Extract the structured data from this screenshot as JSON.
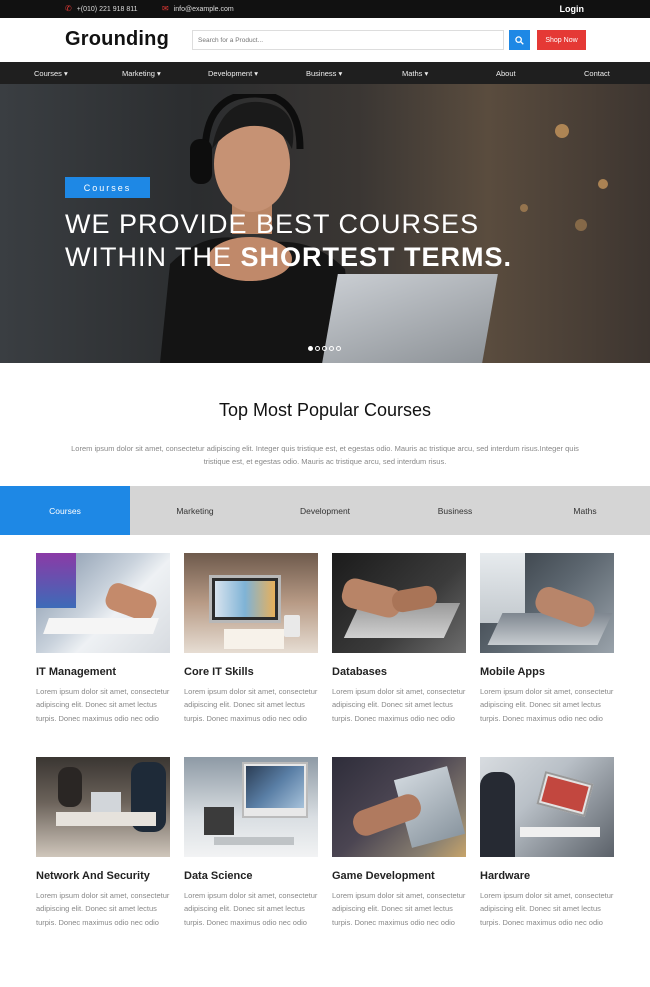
{
  "topbar": {
    "phone": "+(010) 221 918 811",
    "email": "info@example.com",
    "login": "Login"
  },
  "header": {
    "logo": "Grounding",
    "search_placeholder": "Search for a Product...",
    "shop_button": "Shop Now"
  },
  "nav": {
    "items": [
      {
        "label": "Courses ▾"
      },
      {
        "label": "Marketing ▾"
      },
      {
        "label": "Development ▾"
      },
      {
        "label": "Business ▾"
      },
      {
        "label": "Maths ▾"
      },
      {
        "label": "About"
      },
      {
        "label": "Contact"
      }
    ]
  },
  "hero": {
    "badge": "Courses",
    "line1": "WE PROVIDE BEST COURSES",
    "line2_light": "WITHIN THE ",
    "line2_bold": "SHORTEST TERMS.",
    "slides": 5,
    "active_slide": 1
  },
  "section": {
    "title": "Top Most Popular Courses",
    "description": "Lorem ipsum dolor sit amet, consectetur adipiscing elit. Integer quis tristique est, et egestas odio. Mauris ac tristique arcu, sed interdum risus.Integer quis tristique est, et egestas odio. Mauris ac tristique arcu, sed interdum risus."
  },
  "tabs": [
    {
      "label": "Courses"
    },
    {
      "label": "Marketing"
    },
    {
      "label": "Development"
    },
    {
      "label": "Business"
    },
    {
      "label": "Maths"
    }
  ],
  "courses": [
    {
      "title": "IT Management",
      "text": "Lorem ipsum dolor sit amet, consectetur adipiscing elit. Donec sit amet lectus turpis. Donec maximus odio nec odio"
    },
    {
      "title": "Core IT Skills",
      "text": "Lorem ipsum dolor sit amet, consectetur adipiscing elit. Donec sit amet lectus turpis. Donec maximus odio nec odio"
    },
    {
      "title": "Databases",
      "text": "Lorem ipsum dolor sit amet, consectetur adipiscing elit. Donec sit amet lectus turpis. Donec maximus odio nec odio"
    },
    {
      "title": "Mobile Apps",
      "text": "Lorem ipsum dolor sit amet, consectetur adipiscing elit. Donec sit amet lectus turpis. Donec maximus odio nec odio"
    },
    {
      "title": "Network And Security",
      "text": "Lorem ipsum dolor sit amet, consectetur adipiscing elit. Donec sit amet lectus turpis. Donec maximus odio nec odio"
    },
    {
      "title": "Data Science",
      "text": "Lorem ipsum dolor sit amet, consectetur adipiscing elit. Donec sit amet lectus turpis. Donec maximus odio nec odio"
    },
    {
      "title": "Game Development",
      "text": "Lorem ipsum dolor sit amet, consectetur adipiscing elit. Donec sit amet lectus turpis. Donec maximus odio nec odio"
    },
    {
      "title": "Hardware",
      "text": "Lorem ipsum dolor sit amet, consectetur adipiscing elit. Donec sit amet lectus turpis. Donec maximus odio nec odio"
    }
  ],
  "colors": {
    "accent": "#1e88e5",
    "cta": "#e53935",
    "nav": "#1f1f1f",
    "topbar": "#111111"
  }
}
